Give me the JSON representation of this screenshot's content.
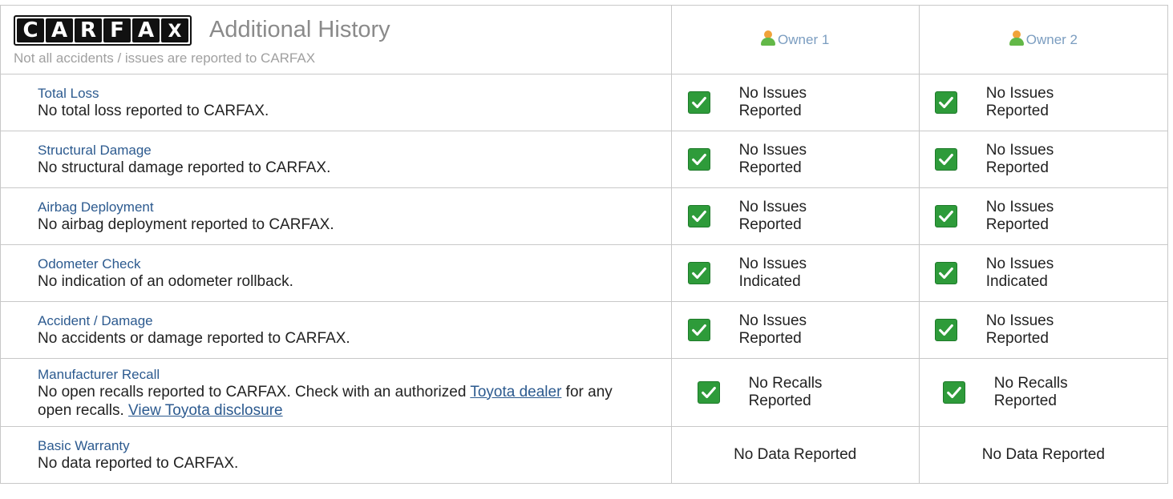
{
  "header": {
    "logo_letters": [
      "C",
      "A",
      "R",
      "F",
      "A",
      "X"
    ],
    "title": "Additional History",
    "subtitle": "Not all accidents / issues are reported to CARFAX",
    "owners": [
      {
        "label": "Owner 1",
        "icon": "person-icon"
      },
      {
        "label": "Owner 2",
        "icon": "person-icon"
      }
    ]
  },
  "rows": [
    {
      "title": "Total Loss",
      "desc": "No total loss reported to CARFAX.",
      "owner1": {
        "line1": "No Issues",
        "line2": "Reported"
      },
      "owner2": {
        "line1": "No Issues",
        "line2": "Reported"
      }
    },
    {
      "title": "Structural Damage",
      "desc": "No structural damage reported to CARFAX.",
      "owner1": {
        "line1": "No Issues",
        "line2": "Reported"
      },
      "owner2": {
        "line1": "No Issues",
        "line2": "Reported"
      }
    },
    {
      "title": "Airbag Deployment",
      "desc": "No airbag deployment reported to CARFAX.",
      "owner1": {
        "line1": "No Issues",
        "line2": "Reported"
      },
      "owner2": {
        "line1": "No Issues",
        "line2": "Reported"
      }
    },
    {
      "title": "Odometer Check",
      "desc": "No indication of an odometer rollback.",
      "owner1": {
        "line1": "No Issues",
        "line2": "Indicated"
      },
      "owner2": {
        "line1": "No Issues",
        "line2": "Indicated"
      }
    },
    {
      "title": "Accident / Damage",
      "desc": "No accidents or damage reported to CARFAX.",
      "owner1": {
        "line1": "No Issues",
        "line2": "Reported"
      },
      "owner2": {
        "line1": "No Issues",
        "line2": "Reported"
      }
    },
    {
      "title": "Manufacturer Recall",
      "desc_before": "No open recalls reported to CARFAX. Check with an authorized ",
      "desc_link1": "Toyota dealer",
      "desc_middle": " for any open recalls. ",
      "desc_link2": "View Toyota disclosure",
      "owner1": {
        "line1": "No Recalls",
        "line2": "Reported"
      },
      "owner2": {
        "line1": "No Recalls",
        "line2": "Reported"
      }
    },
    {
      "title": "Basic Warranty",
      "desc": "No data reported to CARFAX.",
      "owner1": {
        "text": "No Data Reported"
      },
      "owner2": {
        "text": "No Data Reported"
      }
    }
  ],
  "colors": {
    "link": "#2c5a8f",
    "check_green": "#2e9b3a",
    "border": "#c8c8c8",
    "header_text": "#8a8a8a"
  }
}
